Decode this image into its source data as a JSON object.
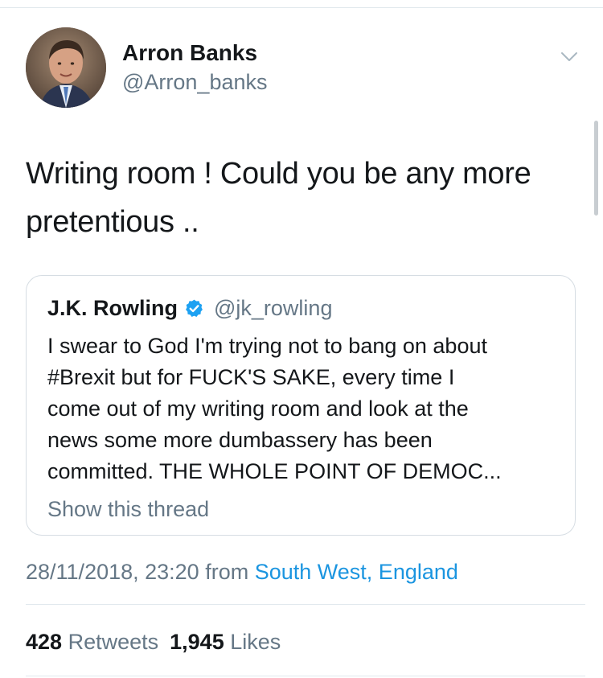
{
  "tweet": {
    "author": {
      "display_name": "Arron Banks",
      "handle": "@Arron_banks"
    },
    "text": "Writing room ! Could you be any more pretentious ..",
    "quoted_tweet": {
      "display_name": "J.K. Rowling",
      "handle": "@jk_rowling",
      "verified": true,
      "text": "I swear to God I'm trying not to bang on about\n#Brexit but for FUCK'S SAKE, every time I\ncome out of my writing room and look at the\nnews some more dumbassery has been\ncommitted. THE WHOLE POINT OF DEMOC...",
      "show_thread_label": "Show this thread"
    },
    "timestamp": "28/11/2018, 23:20",
    "from_label": "from",
    "location": "South West, England",
    "stats": {
      "retweets_count": "428",
      "retweets_label": "Retweets",
      "likes_count": "1,945",
      "likes_label": "Likes"
    }
  },
  "icons": {
    "menu": "chevron-down-icon",
    "verified": "verified-badge-icon"
  },
  "colors": {
    "link": "#1b95e0",
    "secondary_text": "#657786",
    "primary_text": "#14171a",
    "verified": "#1da1f2",
    "divider": "#e1e8ed"
  }
}
